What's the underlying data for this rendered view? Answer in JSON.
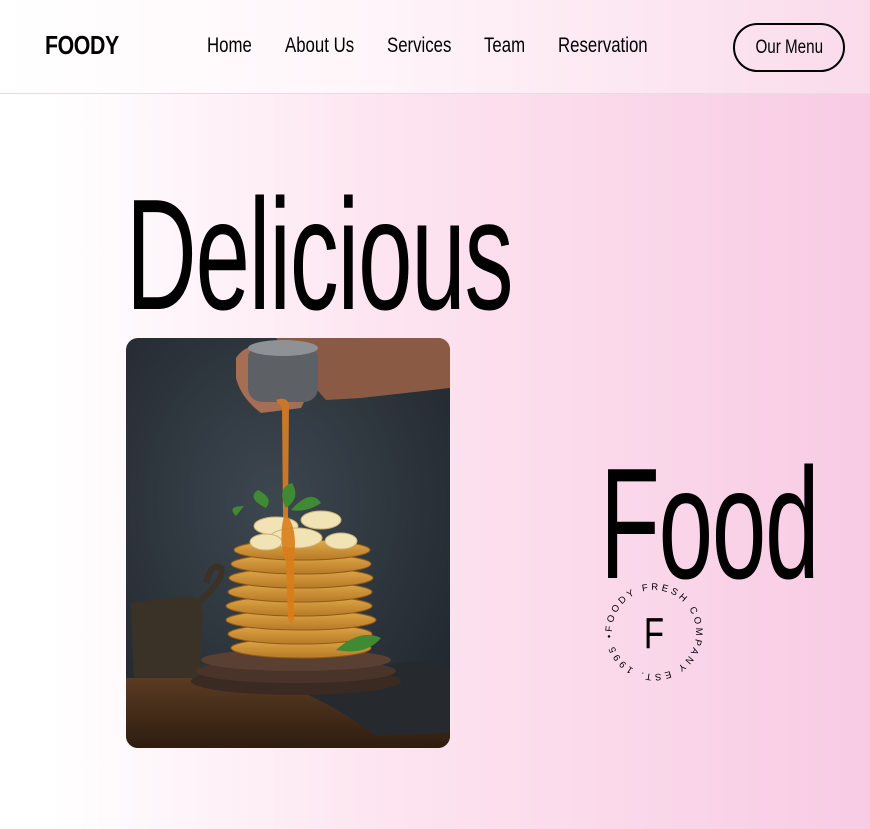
{
  "brand": {
    "name": "FOODY"
  },
  "nav": {
    "items": [
      {
        "label": "Home"
      },
      {
        "label": "About Us"
      },
      {
        "label": "Services"
      },
      {
        "label": "Team"
      },
      {
        "label": "Reservation"
      }
    ],
    "cta_label": "Our Menu"
  },
  "hero": {
    "word1": "Delicious",
    "word2": "Food",
    "image": {
      "subject": "stack of pancakes with bananas and syrup being poured"
    },
    "stamp": {
      "letter": "F",
      "ring_text": "FOODY FRESH COMPANY EST. 1995 •"
    }
  },
  "colors": {
    "gradient_start": "#ffffff",
    "gradient_end": "#f8cbe4",
    "text": "#000000"
  }
}
